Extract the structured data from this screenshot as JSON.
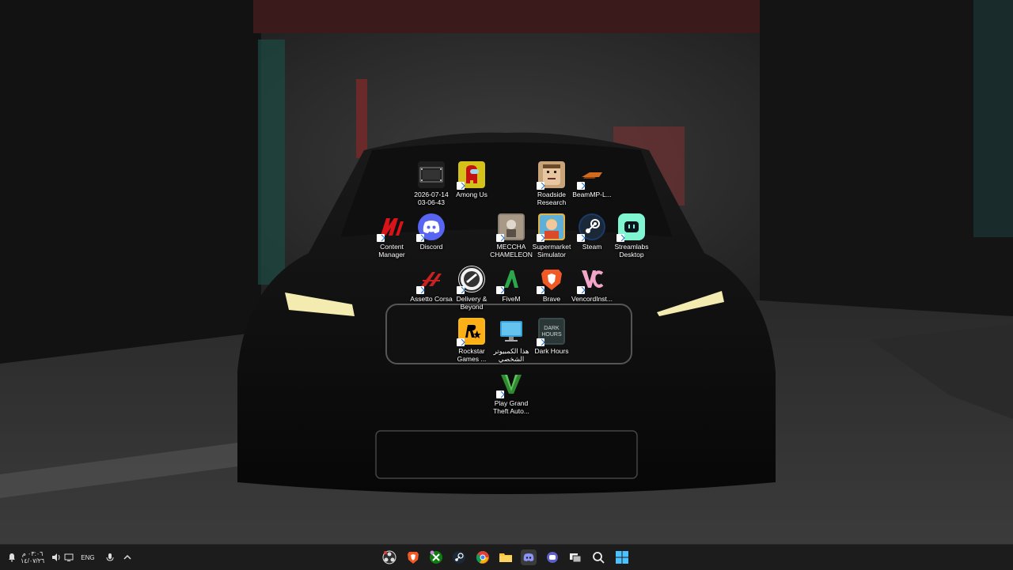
{
  "desktop": {
    "icons": [
      {
        "label": "2026-07-14\n03-06-43",
        "icon": "video-file-icon",
        "color": "#1e1e1e"
      },
      {
        "label": "Among Us",
        "icon": "among-us-icon",
        "color": "#d4c21a"
      },
      {
        "label": "Roadside\nResearch",
        "icon": "roadside-research-icon",
        "color": "#c9a37a"
      },
      {
        "label": "BeamMP-L...",
        "icon": "beammp-icon",
        "color": "#d36b1f"
      },
      {
        "label": "Content\nManager",
        "icon": "content-manager-icon",
        "color": "#c51a1a"
      },
      {
        "label": "Discord",
        "icon": "discord-icon",
        "color": "#5865f2"
      },
      {
        "label": "MECCHA\nCHAMELEON",
        "icon": "meccha-chameleon-icon",
        "color": "#8a7f72"
      },
      {
        "label": "Supermarket\nSimulator",
        "icon": "supermarket-simulator-icon",
        "color": "#e2b24a"
      },
      {
        "label": "Steam",
        "icon": "steam-icon",
        "color": "#1b3a6b"
      },
      {
        "label": "Streamlabs\nDesktop",
        "icon": "streamlabs-icon",
        "color": "#80f5d2"
      },
      {
        "label": "Assetto Corsa",
        "icon": "assetto-corsa-icon",
        "color": "#c62222"
      },
      {
        "label": "Delivery &\nBeyond",
        "icon": "delivery-beyond-icon",
        "color": "#e8e8e8"
      },
      {
        "label": "FiveM",
        "icon": "fivem-icon",
        "color": "#2ba64a"
      },
      {
        "label": "Brave",
        "icon": "brave-icon",
        "color": "#f15a24"
      },
      {
        "label": "VencordInst...",
        "icon": "vencord-icon",
        "color": "#f3a5c9"
      },
      {
        "label": "Rockstar\nGames ...",
        "icon": "rockstar-icon",
        "color": "#f5b71a"
      },
      {
        "label": "هذا الكمبيوتر\nالشخصي",
        "icon": "this-pc-icon",
        "color": "#3aa0d8"
      },
      {
        "label": "Dark Hours",
        "icon": "dark-hours-icon",
        "color": "#3a4a4a"
      },
      {
        "label": "Play Grand\nTheft Auto...",
        "icon": "gta-v-icon",
        "color": "#2f8a2f"
      }
    ]
  },
  "taskbar": {
    "apps": [
      {
        "name": "obs-icon"
      },
      {
        "name": "brave-icon"
      },
      {
        "name": "xbox-icon"
      },
      {
        "name": "steam-icon"
      },
      {
        "name": "chrome-icon"
      },
      {
        "name": "file-explorer-icon"
      },
      {
        "name": "discord-icon"
      },
      {
        "name": "chat-icon"
      },
      {
        "name": "task-view-icon"
      },
      {
        "name": "search-icon"
      },
      {
        "name": "start-icon"
      }
    ],
    "tray": {
      "time": "٠٣:٠٦ م",
      "date": "١٤/٠٧/٢٦",
      "language": "ENG"
    }
  }
}
